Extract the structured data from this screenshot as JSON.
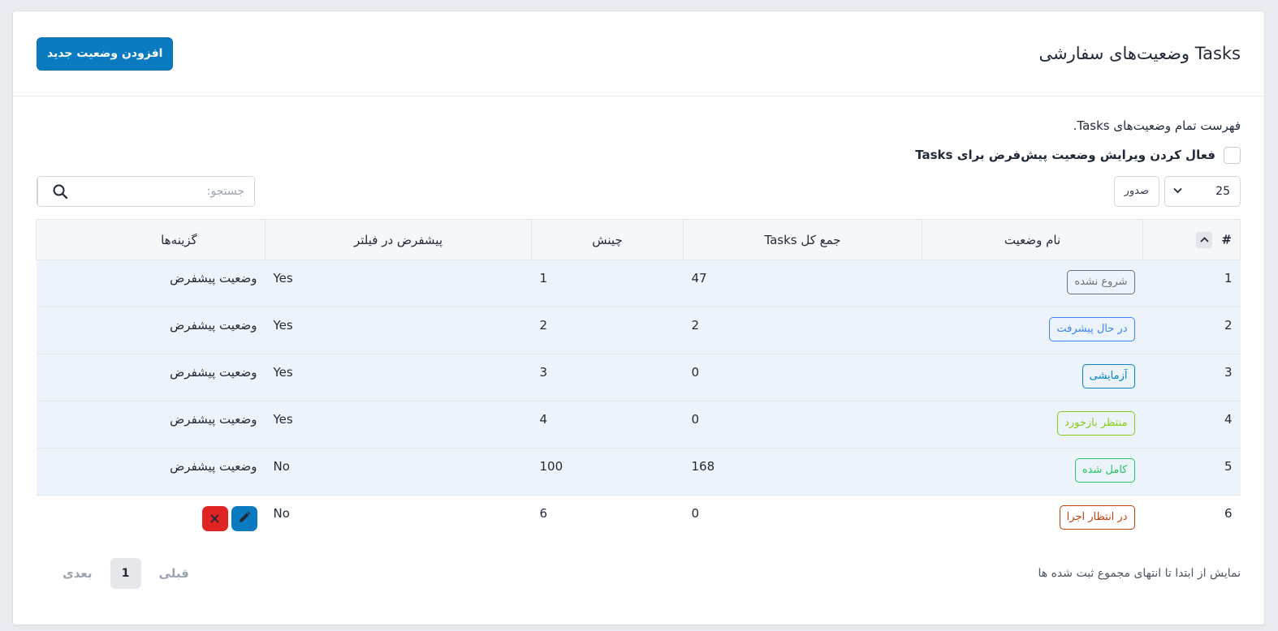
{
  "header": {
    "title": "Tasks وضعیت‌های سفارشی",
    "add_button": "افزودن وضعیت جدید"
  },
  "description": "فهرست تمام وضعیت‌های Tasks.",
  "default_edit": {
    "label": "فعال کردن ویرایش وضعیت پیش‌فرض برای Tasks",
    "checked": false
  },
  "toolbar": {
    "page_length": "25",
    "export_label": "صدور",
    "search_placeholder": "جستجو:"
  },
  "table": {
    "columns": {
      "num": "#",
      "name": "نام وضعیت",
      "total": "جمع کل Tasks",
      "order": "چینش",
      "default_filter": "پیشفرض در فیلتر",
      "options": "گزینه‌ها"
    },
    "rows": [
      {
        "num": "1",
        "name": "شروع نشده",
        "color": "#6b7280",
        "total": "47",
        "order": "1",
        "default_filter": "Yes",
        "options": "وضعیت پیشفرض"
      },
      {
        "num": "2",
        "name": "در حال پیشرفت",
        "color": "#3b82f6",
        "total": "2",
        "order": "2",
        "default_filter": "Yes",
        "options": "وضعیت پیشفرض"
      },
      {
        "num": "3",
        "name": "آزمایشی",
        "color": "#0284c7",
        "total": "0",
        "order": "3",
        "default_filter": "Yes",
        "options": "وضعیت پیشفرض"
      },
      {
        "num": "4",
        "name": "منتظر بازخورد",
        "color": "#84cc16",
        "total": "0",
        "order": "4",
        "default_filter": "Yes",
        "options": "وضعیت پیشفرض"
      },
      {
        "num": "5",
        "name": "کامل شده",
        "color": "#22c55e",
        "total": "168",
        "order": "100",
        "default_filter": "No",
        "options": "وضعیت پیشفرض"
      },
      {
        "num": "6",
        "name": "در انتظار اجرا",
        "color": "#c2410c",
        "total": "0",
        "order": "6",
        "default_filter": "No",
        "options": ""
      }
    ]
  },
  "footer": {
    "info": "نمایش از ابتدا تا انتهای مجموع ثبت شده ها",
    "prev": "قبلی",
    "page": "1",
    "next": "بعدی"
  },
  "colors": {
    "primary": "#0b7bc1",
    "danger": "#e02424",
    "row_highlight": "#edf3fb"
  }
}
